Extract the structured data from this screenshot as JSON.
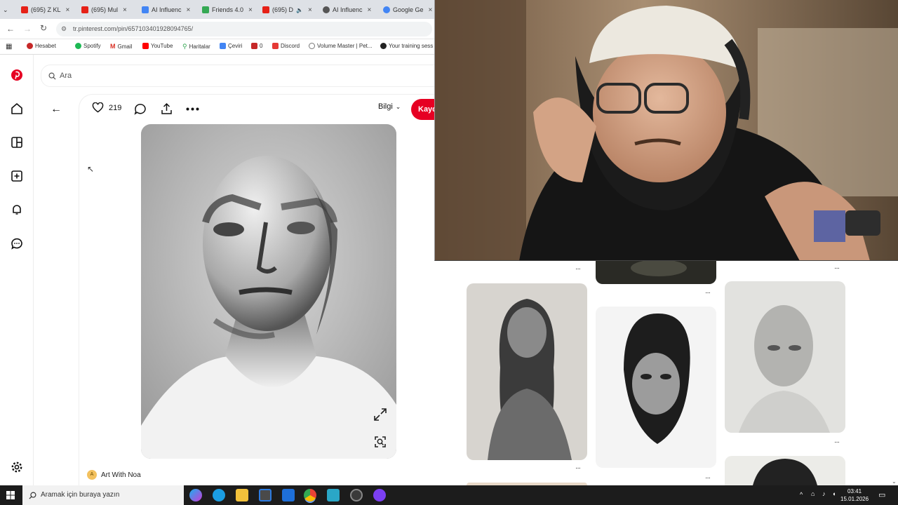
{
  "browser": {
    "tabs": [
      {
        "label": "(695) Z KL",
        "fav_color": "#e62117"
      },
      {
        "label": "(695) Mul",
        "fav_color": "#e62117"
      },
      {
        "label": "AI Influenc",
        "fav_color": "#4285f4"
      },
      {
        "label": "Friends 4.0",
        "fav_color": "#34a853"
      },
      {
        "label": "(695) D",
        "fav_color": "#e62117"
      },
      {
        "label": "AI Influenc",
        "fav_color": "#555555"
      },
      {
        "label": "Google Ge",
        "fav_color": "#4285f4"
      }
    ],
    "url": "tr.pinterest.com/pin/657103401928094765/",
    "bookmarks": [
      {
        "label": "Hesabet",
        "color": "#c62828"
      },
      {
        "label": "Spotify",
        "color": "#1db954"
      },
      {
        "label": "Gmail",
        "color": "#d93025"
      },
      {
        "label": "YouTube",
        "color": "#ff0000"
      },
      {
        "label": "Haritalar",
        "color": "#34a853"
      },
      {
        "label": "Çeviri",
        "color": "#4285f4"
      },
      {
        "label": "0",
        "color": "#c62828"
      },
      {
        "label": "Discord",
        "color": "#e53935"
      },
      {
        "label": "Volume Master | Pet...",
        "color": "#777777"
      },
      {
        "label": "Your training sess",
        "color": "#222222"
      }
    ]
  },
  "pinterest": {
    "search_placeholder": "Ara",
    "like_count": "219",
    "info_label": "Bilgi",
    "save_label": "Kaydet",
    "author_initial": "A",
    "author_name": "Art With Noa",
    "brand_color": "#e60023"
  },
  "taskbar": {
    "search_placeholder": "Aramak için buraya yazın",
    "time": "03:41",
    "date": "15.01.2026"
  }
}
